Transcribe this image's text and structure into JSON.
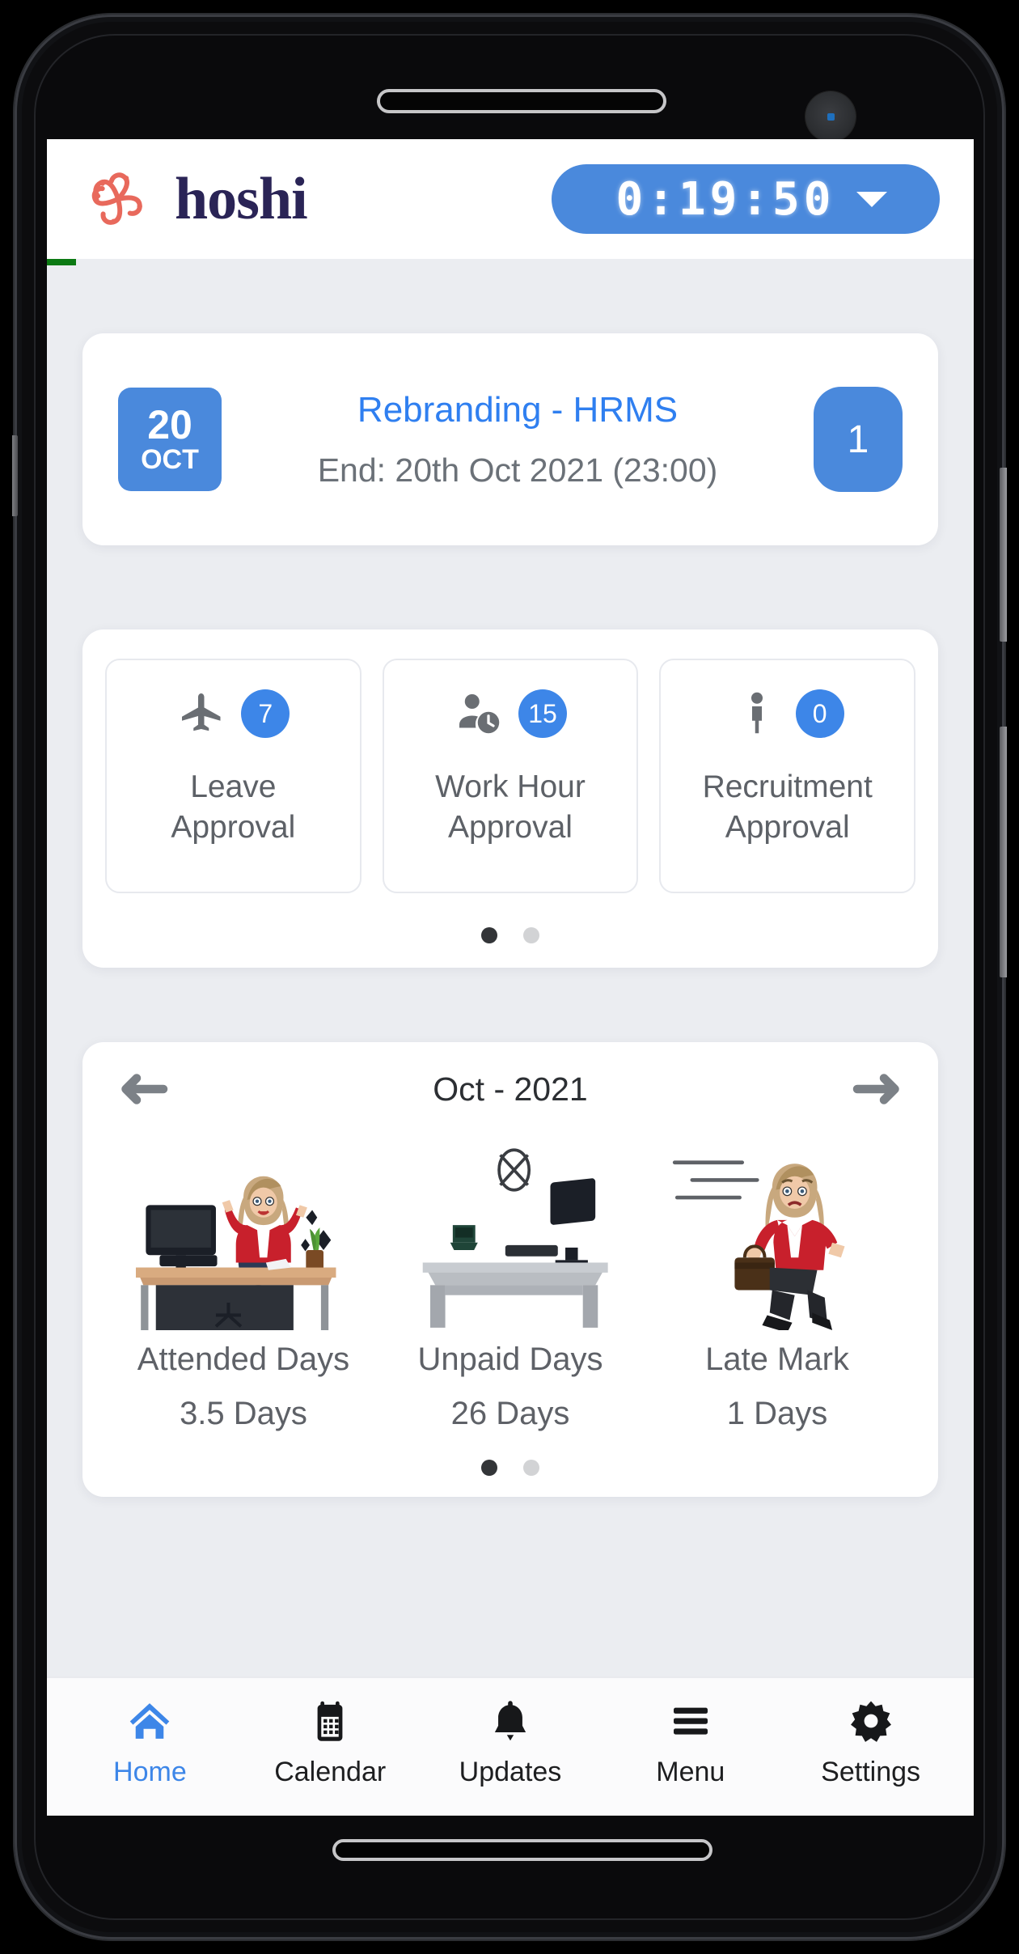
{
  "app": {
    "brand_name": "hoshi",
    "brand_mark_icon": "hoshi-pinwheel-logo",
    "accent_blue": "#4a89dc",
    "link_blue": "#2f7ff0",
    "brand_navy": "#2a2456",
    "brand_coral": "#e8695c",
    "progress_green": "#0c7a14",
    "screen_bg": "#ebedf1"
  },
  "header": {
    "timer_value": "0:19:50",
    "timer_caret_icon": "chevron-down-icon"
  },
  "task_card": {
    "date_day": "20",
    "date_month": "OCT",
    "title": "Rebranding - HRMS",
    "subtitle": "End: 20th Oct 2021 (23:00)",
    "count": "1"
  },
  "approvals": {
    "tiles": [
      {
        "icon": "airplane-icon",
        "badge": "7",
        "label": "Leave\nApproval",
        "label_line1": "Leave",
        "label_line2": "Approval"
      },
      {
        "icon": "person-clock-icon",
        "badge": "15",
        "label": "Work Hour\nApproval",
        "label_line1": "Work Hour",
        "label_line2": "Approval"
      },
      {
        "icon": "person-icon",
        "badge": "0",
        "label": "Recruitment\nApproval",
        "label_line1": "Recruitment",
        "label_line2": "Approval"
      }
    ],
    "pagination": {
      "total": 2,
      "active_index": 0
    }
  },
  "stats": {
    "prev_icon": "arrow-left-icon",
    "next_icon": "arrow-right-icon",
    "month": "Oct - 2021",
    "items": [
      {
        "art": "happy-woman-at-desk-illustration",
        "name": "Attended Days",
        "value": "3.5 Days"
      },
      {
        "art": "empty-desk-illustration",
        "name": "Unpaid Days",
        "value": "26 Days"
      },
      {
        "art": "running-late-woman-illustration",
        "name": "Late Mark",
        "value": "1 Days"
      }
    ],
    "pagination": {
      "total": 2,
      "active_index": 0
    }
  },
  "bottom_nav": {
    "items": [
      {
        "icon": "home-icon",
        "label": "Home",
        "active": true
      },
      {
        "icon": "calendar-icon",
        "label": "Calendar",
        "active": false
      },
      {
        "icon": "bell-icon",
        "label": "Updates",
        "active": false
      },
      {
        "icon": "hamburger-menu-icon",
        "label": "Menu",
        "active": false
      },
      {
        "icon": "gear-icon",
        "label": "Settings",
        "active": false
      }
    ]
  },
  "device": {
    "earpiece_icon": "earpiece-speaker",
    "camera_icon": "front-camera",
    "home_indicator_icon": "home-indicator-bar"
  }
}
